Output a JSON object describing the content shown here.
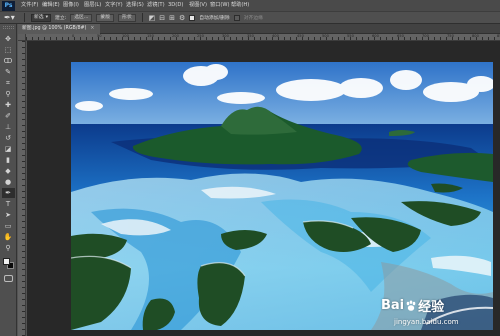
{
  "app": {
    "logo_text": "Ps",
    "accent_color": "#59b7ff"
  },
  "menu": {
    "items": [
      "文件(F)",
      "编辑(E)",
      "图像(I)",
      "图层(L)",
      "文字(Y)",
      "选择(S)",
      "滤镜(T)",
      "3D(D)",
      "视图(V)",
      "窗口(W)",
      "帮助(H)"
    ]
  },
  "options": {
    "mode_select": "新选",
    "mode_arrow": "▾",
    "new_label": "建立:",
    "selection_btn": "选区...",
    "mask_btn": "蒙版",
    "shape_btn": "形状",
    "auto_add_checked": true,
    "auto_add_label": "自动添加/删除",
    "align_edges_label": "对齐边缘"
  },
  "document": {
    "tab_title": "新图.jpg @ 100% (RGB/8#)",
    "close_glyph": "×"
  },
  "rulers": {
    "h_numbers": [
      "0",
      "50",
      "100",
      "150",
      "200",
      "250",
      "300",
      "350",
      "400",
      "450",
      "500",
      "550",
      "600",
      "650",
      "700",
      "750",
      "800",
      "850"
    ]
  },
  "tools": [
    {
      "name": "move-tool",
      "glyph": "✥"
    },
    {
      "name": "marquee-tool",
      "glyph": "⬚"
    },
    {
      "name": "lasso-tool",
      "glyph": "ↀ"
    },
    {
      "name": "quick-select-tool",
      "glyph": "✎"
    },
    {
      "name": "crop-tool",
      "glyph": "⌗"
    },
    {
      "name": "eyedropper-tool",
      "glyph": "⚲"
    },
    {
      "name": "healing-brush-tool",
      "glyph": "✚"
    },
    {
      "name": "brush-tool",
      "glyph": "✐"
    },
    {
      "name": "clone-stamp-tool",
      "glyph": "⊥"
    },
    {
      "name": "history-brush-tool",
      "glyph": "↺"
    },
    {
      "name": "eraser-tool",
      "glyph": "◪"
    },
    {
      "name": "gradient-tool",
      "glyph": "▮"
    },
    {
      "name": "blur-tool",
      "glyph": "◆"
    },
    {
      "name": "dodge-tool",
      "glyph": "●"
    },
    {
      "name": "pen-tool",
      "glyph": "✒"
    },
    {
      "name": "type-tool",
      "glyph": "T"
    },
    {
      "name": "path-select-tool",
      "glyph": "➤"
    },
    {
      "name": "shape-tool",
      "glyph": "▭"
    },
    {
      "name": "hand-tool",
      "glyph": "✋"
    },
    {
      "name": "zoom-tool",
      "glyph": "⚲"
    }
  ],
  "watermark": {
    "brand_left": "Bai",
    "brand_right": "经验",
    "url": "jingyan.baidu.com"
  }
}
